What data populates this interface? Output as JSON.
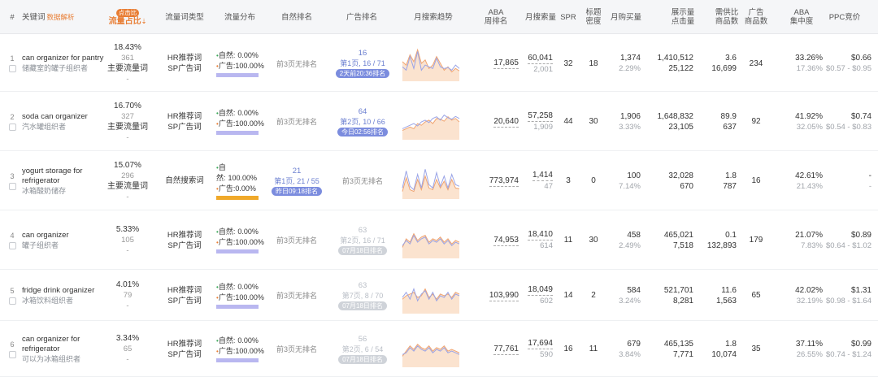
{
  "header": {
    "hash": "#",
    "keyword": "关键词",
    "keyword_sub": "数据解析",
    "share_badge": "点击比",
    "share_title": "流量占比",
    "share_arrow": "⇣",
    "type": "流量词类型",
    "flow": "流量分布",
    "natural_rank": "自然排名",
    "ad_rank": "广告排名",
    "trend": "月搜索趋势",
    "aba_l1": "ABA",
    "aba_l2": "周排名",
    "monthly_search": "月搜索量",
    "spr": "SPR",
    "title_l1": "标题",
    "title_l2": "密度",
    "monthly_buy": "月购买量",
    "impr_l1": "展示量",
    "impr_l2": "点击量",
    "ratio_l1": "需供比",
    "ratio_l2": "商品数",
    "adprod_l1": "广告",
    "adprod_l2": "商品数",
    "conc_l1": "ABA",
    "conc_l2": "集中度",
    "ppc": "PPC竞价"
  },
  "colors": {
    "natural_bar": "#b9b7f0",
    "search_bar": "#f0a92a",
    "spark_line1": "#9aa4e6",
    "spark_line2": "#f0a470",
    "spark_fill": "#fbe3cf"
  },
  "rows": [
    {
      "idx": "1",
      "kw_en1": "can organizer for pantry",
      "kw_en2": "",
      "kw_cn": "储藏室的罐子组织者",
      "share_pct": "18.43%",
      "share_num": "361",
      "share_lbl": "主要流量词",
      "share_dash": "-",
      "type1": "HR推荐词",
      "type2": "SP广告词",
      "nat_label": "自然:",
      "nat_val": "0.00%",
      "ad_label": "广告:",
      "ad_val": "100.00%",
      "bar": "natural",
      "natural_rank": "前3页无排名",
      "ad_top": "16",
      "ad_mid": "第1页, 16 / 71",
      "ad_tag": "2天前20:36排名",
      "ad_gray": false,
      "aba": "17,865",
      "search1": "60,041",
      "search2": "2,001",
      "spr": "32",
      "title_density": "18",
      "buy1": "1,374",
      "buy2": "2.29%",
      "impr1": "1,410,512",
      "impr2": "25,122",
      "ratio1": "3.6",
      "ratio2": "16,699",
      "ad_products": "234",
      "conc1": "33.26%",
      "conc2": "17.36%",
      "ppc1": "$0.66",
      "ppc2": "$0.57 - $0.95",
      "spark1": [
        40,
        30,
        70,
        35,
        85,
        30,
        45,
        40,
        35,
        65,
        40,
        35,
        38,
        30,
        45,
        35
      ],
      "spark2": [
        55,
        45,
        75,
        55,
        90,
        50,
        60,
        35,
        45,
        70,
        50,
        30,
        40,
        25,
        35,
        28
      ]
    },
    {
      "idx": "2",
      "kw_en1": "soda can organizer",
      "kw_en2": "",
      "kw_cn": "汽水罐组织者",
      "share_pct": "16.70%",
      "share_num": "327",
      "share_lbl": "主要流量词",
      "share_dash": "-",
      "type1": "HR推荐词",
      "type2": "SP广告词",
      "nat_label": "自然:",
      "nat_val": "0.00%",
      "ad_label": "广告:",
      "ad_val": "100.00%",
      "bar": "natural",
      "natural_rank": "前3页无排名",
      "ad_top": "64",
      "ad_mid": "第2页, 10 / 66",
      "ad_tag": "今日02:56排名",
      "ad_gray": false,
      "aba": "20,640",
      "search1": "57,258",
      "search2": "1,909",
      "spr": "44",
      "title_density": "30",
      "buy1": "1,906",
      "buy2": "3.33%",
      "impr1": "1,648,832",
      "impr2": "23,105",
      "ratio1": "89.9",
      "ratio2": "637",
      "ad_products": "92",
      "conc1": "41.92%",
      "conc2": "32.05%",
      "ppc1": "$0.74",
      "ppc2": "$0.54 - $0.83",
      "spark1": [
        30,
        35,
        40,
        45,
        38,
        50,
        55,
        48,
        60,
        65,
        55,
        70,
        62,
        58,
        66,
        60
      ],
      "spark2": [
        25,
        30,
        35,
        30,
        45,
        40,
        50,
        55,
        45,
        60,
        58,
        52,
        65,
        55,
        60,
        50
      ]
    },
    {
      "idx": "3",
      "kw_en1": "yogurt storage for",
      "kw_en2": "refrigerator",
      "kw_cn": "冰箱酸奶储存",
      "share_pct": "15.07%",
      "share_num": "296",
      "share_lbl": "主要流量词",
      "share_dash": "-",
      "type1": "自然搜索词",
      "type2": "",
      "nat_label": "自然:",
      "nat_val": "100.00%",
      "ad_label": "广告:",
      "ad_val": "0.00%",
      "bar": "search",
      "natural_rank": "",
      "nat_top": "21",
      "nat_mid": "第1页, 21 / 55",
      "nat_tag": "昨日09:18排名",
      "ad_top": "",
      "ad_mid": "",
      "ad_tag": "",
      "ad_text": "前3页无排名",
      "ad_gray": false,
      "aba": "773,974",
      "search1": "1,414",
      "search2": "47",
      "spr": "3",
      "title_density": "0",
      "buy1": "100",
      "buy2": "7.14%",
      "impr1": "32,028",
      "impr2": "670",
      "ratio1": "1.8",
      "ratio2": "787",
      "ad_products": "16",
      "conc1": "42.61%",
      "conc2": "21.43%",
      "ppc1": "-",
      "ppc2": "-",
      "spark1": [
        30,
        80,
        35,
        25,
        70,
        30,
        85,
        40,
        30,
        75,
        35,
        65,
        30,
        70,
        40,
        35
      ],
      "spark2": [
        20,
        60,
        25,
        20,
        55,
        25,
        65,
        30,
        25,
        55,
        30,
        50,
        25,
        55,
        30,
        28
      ]
    },
    {
      "idx": "4",
      "kw_en1": "can organizer",
      "kw_en2": "",
      "kw_cn": "罐子组织者",
      "share_pct": "5.33%",
      "share_num": "105",
      "share_lbl": "",
      "share_dash": "-",
      "type1": "HR推荐词",
      "type2": "SP广告词",
      "nat_label": "自然:",
      "nat_val": "0.00%",
      "ad_label": "广告:",
      "ad_val": "100.00%",
      "bar": "natural",
      "natural_rank": "前3页无排名",
      "ad_top": "63",
      "ad_mid": "第2页, 16 / 71",
      "ad_tag": "07月18日排名",
      "ad_gray": true,
      "aba": "74,953",
      "search1": "18,410",
      "search2": "614",
      "spr": "11",
      "title_density": "30",
      "buy1": "458",
      "buy2": "2.49%",
      "impr1": "465,021",
      "impr2": "7,518",
      "ratio1": "0.1",
      "ratio2": "132,893",
      "ad_products": "179",
      "conc1": "21.07%",
      "conc2": "7.83%",
      "ppc1": "$0.89",
      "ppc2": "$0.64 - $1.02",
      "spark1": [
        35,
        50,
        40,
        65,
        45,
        55,
        60,
        40,
        50,
        45,
        55,
        40,
        50,
        35,
        45,
        40
      ],
      "spark2": [
        30,
        55,
        45,
        70,
        50,
        60,
        65,
        45,
        55,
        50,
        60,
        45,
        55,
        40,
        50,
        45
      ]
    },
    {
      "idx": "5",
      "kw_en1": "fridge drink organizer",
      "kw_en2": "",
      "kw_cn": "冰箱饮料组织者",
      "share_pct": "4.01%",
      "share_num": "79",
      "share_lbl": "",
      "share_dash": "-",
      "type1": "HR推荐词",
      "type2": "SP广告词",
      "nat_label": "自然:",
      "nat_val": "0.00%",
      "ad_label": "广告:",
      "ad_val": "100.00%",
      "bar": "natural",
      "natural_rank": "前3页无排名",
      "ad_top": "63",
      "ad_mid": "第7页, 8 / 70",
      "ad_tag": "07月18日排名",
      "ad_gray": true,
      "aba": "103,990",
      "search1": "18,049",
      "search2": "602",
      "spr": "14",
      "title_density": "2",
      "buy1": "584",
      "buy2": "3.24%",
      "impr1": "521,701",
      "impr2": "8,281",
      "ratio1": "11.6",
      "ratio2": "1,563",
      "ad_products": "65",
      "conc1": "42.02%",
      "conc2": "32.19%",
      "ppc1": "$1.31",
      "ppc2": "$0.98 - $1.64",
      "spark1": [
        45,
        60,
        40,
        70,
        35,
        55,
        65,
        40,
        60,
        35,
        50,
        45,
        60,
        40,
        55,
        50
      ],
      "spark2": [
        40,
        50,
        55,
        60,
        45,
        50,
        70,
        45,
        55,
        40,
        55,
        50,
        55,
        45,
        60,
        55
      ]
    },
    {
      "idx": "6",
      "kw_en1": "can organizer for",
      "kw_en2": "refrigerator",
      "kw_cn": "可以为冰箱组织者",
      "share_pct": "3.34%",
      "share_num": "65",
      "share_lbl": "",
      "share_dash": "-",
      "type1": "HR推荐词",
      "type2": "SP广告词",
      "nat_label": "自然:",
      "nat_val": "0.00%",
      "ad_label": "广告:",
      "ad_val": "100.00%",
      "bar": "natural",
      "natural_rank": "前3页无排名",
      "ad_top": "56",
      "ad_mid": "第2页, 6 / 54",
      "ad_tag": "07月18日排名",
      "ad_gray": true,
      "aba": "77,761",
      "search1": "17,694",
      "search2": "590",
      "spr": "16",
      "title_density": "11",
      "buy1": "679",
      "buy2": "3.84%",
      "impr1": "465,135",
      "impr2": "7,771",
      "ratio1": "1.8",
      "ratio2": "10,074",
      "ad_products": "35",
      "conc1": "37.11%",
      "conc2": "26.55%",
      "ppc1": "$0.99",
      "ppc2": "$0.74 - $1.24",
      "spark1": [
        35,
        40,
        55,
        45,
        60,
        50,
        45,
        55,
        40,
        50,
        45,
        55,
        40,
        45,
        40,
        35
      ],
      "spark2": [
        30,
        45,
        60,
        50,
        65,
        55,
        50,
        60,
        45,
        55,
        50,
        60,
        45,
        50,
        45,
        40
      ]
    }
  ]
}
